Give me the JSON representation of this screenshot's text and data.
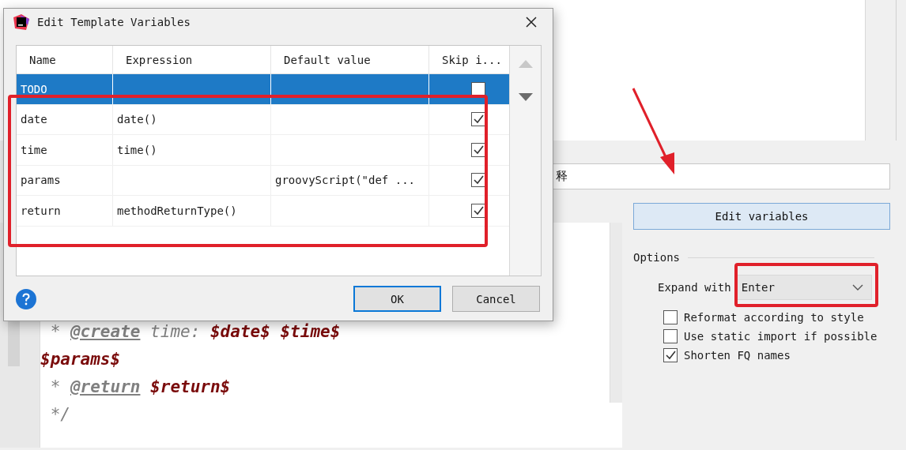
{
  "description_field": {
    "value": "释"
  },
  "edit_variables_button": "Edit variables",
  "options": {
    "title": "Options",
    "expand_label": "Expand with",
    "expand_value": "Enter",
    "checkboxes": [
      {
        "label": "Reformat according to style",
        "checked": false
      },
      {
        "label": "Use static import if possible",
        "checked": false
      },
      {
        "label": "Shorten FQ names",
        "checked": true
      }
    ]
  },
  "template_lines": [
    [
      {
        "text": " * ",
        "kind": "comment"
      },
      {
        "text": "@create",
        "kind": "tag"
      },
      {
        "text": " time: ",
        "kind": "comment"
      },
      {
        "text": "$date$ $time$",
        "kind": "variable"
      }
    ],
    [
      {
        "text": "$params$",
        "kind": "variable"
      }
    ],
    [
      {
        "text": " * ",
        "kind": "comment"
      },
      {
        "text": "@return",
        "kind": "tag"
      },
      {
        "text": " $return$",
        "kind": "variable"
      }
    ],
    [
      {
        "text": " */",
        "kind": "comment"
      }
    ]
  ],
  "dialog": {
    "title": "Edit Template Variables",
    "columns": [
      "Name",
      "Expression",
      "Default value",
      "Skip i..."
    ],
    "rows": [
      {
        "name": "TODO",
        "expression": "",
        "default_value": "",
        "skip": false,
        "selected": true
      },
      {
        "name": "date",
        "expression": "date()",
        "default_value": "",
        "skip": true,
        "selected": false
      },
      {
        "name": "time",
        "expression": "time()",
        "default_value": "",
        "skip": true,
        "selected": false
      },
      {
        "name": "params",
        "expression": "",
        "default_value": "groovyScript(\"def ...",
        "skip": true,
        "selected": false
      },
      {
        "name": "return",
        "expression": "methodReturnType()",
        "default_value": "",
        "skip": true,
        "selected": false
      }
    ],
    "buttons": [
      "OK",
      "Cancel"
    ]
  }
}
